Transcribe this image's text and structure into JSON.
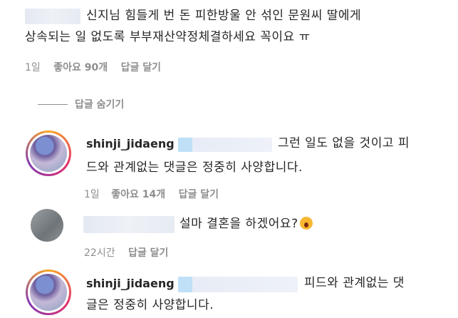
{
  "comment1": {
    "text_line1": "신지님 힘들게 번 돈 피한방울 안 섞인 문원씨 딸에게",
    "text_line2": "상속되는 일 없도록 부부재산약정체결하세요 꼭이요 ㅠ",
    "time": "1일",
    "likes": "좋아요 90개",
    "reply": "답글 달기"
  },
  "hide_replies": "답글 숨기기",
  "reply1": {
    "username": "shinji_jidaeng",
    "text_line1": "그런 일도 없을 것이고 피",
    "text_line2": "드와 관계없는 댓글은 정중히 사양합니다.",
    "time": "1일",
    "likes": "좋아요 14개",
    "reply": "답글 달기"
  },
  "reply2": {
    "text": "설마 결혼을 하겠어요?",
    "time": "22시간",
    "reply": "답글 달기",
    "emoji": "astonished-emoji"
  },
  "reply3": {
    "username": "shinji_jidaeng",
    "text_line1": "피드와 관계없는 댓",
    "text_line2": "글은 정중히 사양합니다."
  }
}
